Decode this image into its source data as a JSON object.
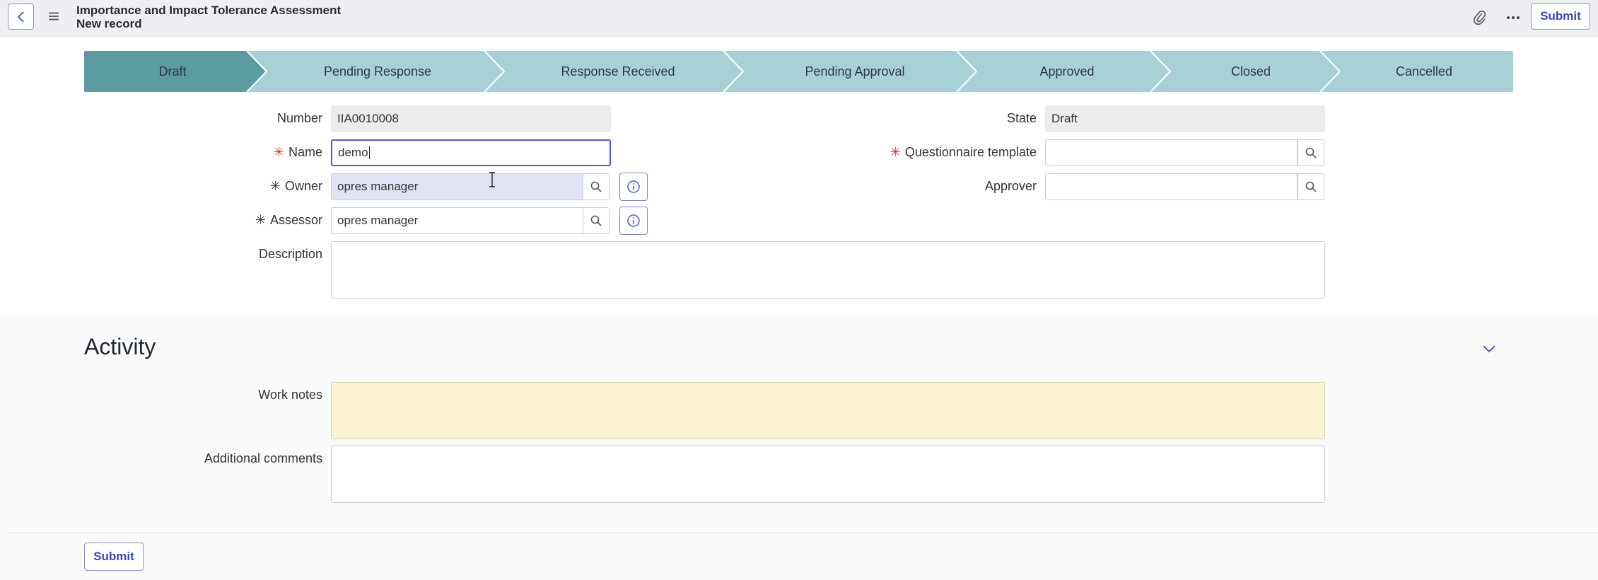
{
  "header": {
    "title": "Importance and Impact Tolerance Assessment",
    "subtitle": "New record",
    "submit_label": "Submit"
  },
  "stages": [
    {
      "label": "Draft",
      "active": true
    },
    {
      "label": "Pending Response",
      "active": false
    },
    {
      "label": "Response Received",
      "active": false
    },
    {
      "label": "Pending Approval",
      "active": false
    },
    {
      "label": "Approved",
      "active": false
    },
    {
      "label": "Closed",
      "active": false
    },
    {
      "label": "Cancelled",
      "active": false
    }
  ],
  "form": {
    "number_label": "Number",
    "number_value": "IIA0010008",
    "name_label": "Name",
    "name_value": "demo",
    "owner_label": "Owner",
    "owner_value": "opres manager",
    "assessor_label": "Assessor",
    "assessor_value": "opres manager",
    "description_label": "Description",
    "state_label": "State",
    "state_value": "Draft",
    "questionnaire_label": "Questionnaire template",
    "questionnaire_value": "",
    "approver_label": "Approver",
    "approver_value": ""
  },
  "activity": {
    "title": "Activity",
    "work_notes_label": "Work notes",
    "additional_comments_label": "Additional comments"
  },
  "footer": {
    "submit_label": "Submit"
  },
  "colors": {
    "accent": "#3c4ab8",
    "stage_active": "#5c9ba0",
    "stage_inactive": "#a8d1d6",
    "required": "#c8362f",
    "work_notes_bg": "#faf3d1"
  }
}
